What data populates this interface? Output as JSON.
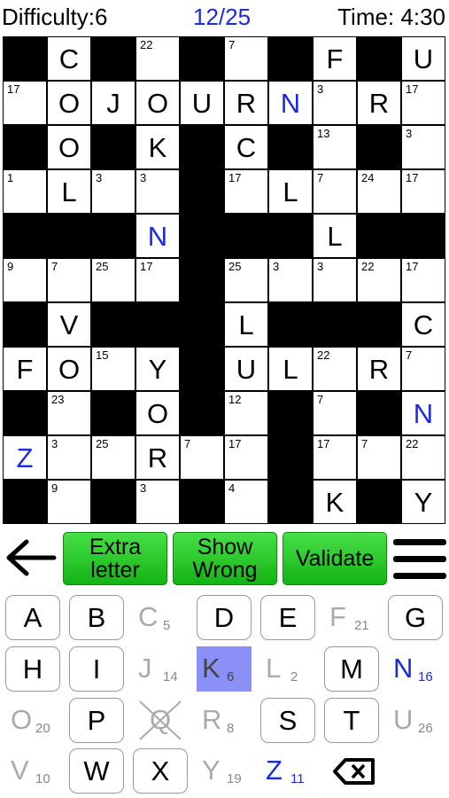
{
  "header": {
    "difficulty": "Difficulty:6",
    "progress": "12/25",
    "time": "Time: 4:30"
  },
  "grid": {
    "rows": [
      [
        "#",
        {
          "l": "C"
        },
        "#",
        {
          "n": "22"
        },
        "#",
        {
          "n": "7"
        },
        "#",
        {
          "l": "F"
        },
        "#",
        {
          "l": "U"
        }
      ],
      [
        {
          "n": "17"
        },
        {
          "l": "O"
        },
        {
          "l": "J"
        },
        {
          "l": "O"
        },
        {
          "l": "U"
        },
        {
          "l": "R"
        },
        {
          "l": "N",
          "c": "blue"
        },
        {
          "n": "3"
        },
        {
          "l": "R"
        },
        {
          "n": "17"
        }
      ],
      [
        "#",
        {
          "l": "O"
        },
        "#",
        {
          "l": "K"
        },
        "#",
        {
          "l": "C"
        },
        "#",
        {
          "n": "13"
        },
        "#",
        {
          "n": "3"
        }
      ],
      [
        {
          "n": "1"
        },
        {
          "l": "L"
        },
        {
          "n": "3"
        },
        {
          "n": "3"
        },
        "#",
        {
          "n": "17"
        },
        {
          "l": "L"
        },
        {
          "n": "7"
        },
        {
          "n": "24"
        },
        {
          "n": "17"
        }
      ],
      [
        "#",
        "#",
        "#",
        {
          "l": "N",
          "c": "blue"
        },
        "#",
        "#",
        "#",
        {
          "l": "L"
        },
        "#",
        "#"
      ],
      [
        {
          "n": "9"
        },
        {
          "n": "7"
        },
        {
          "n": "25"
        },
        {
          "n": "17"
        },
        "#",
        {
          "n": "25"
        },
        {
          "n": "3"
        },
        {
          "n": "3"
        },
        {
          "n": "22"
        },
        {
          "n": "17"
        }
      ],
      [
        "#",
        {
          "l": "V"
        },
        "#",
        "#",
        "#",
        {
          "l": "L"
        },
        "#",
        "#",
        "#",
        {
          "l": "C"
        }
      ],
      [
        {
          "l": "F"
        },
        {
          "l": "O"
        },
        {
          "n": "15"
        },
        {
          "l": "Y"
        },
        "#",
        {
          "l": "U"
        },
        {
          "l": "L"
        },
        {
          "n": "22"
        },
        {
          "l": "R"
        },
        {
          "n": "7"
        }
      ],
      [
        "#",
        {
          "n": "23"
        },
        "#",
        {
          "l": "O"
        },
        "#",
        {
          "n": "12"
        },
        "#",
        {
          "n": "7"
        },
        "#",
        {
          "l": "N",
          "c": "blue"
        }
      ],
      [
        {
          "l": "Z",
          "c": "blue"
        },
        {
          "n": "3"
        },
        {
          "n": "25"
        },
        {
          "l": "R"
        },
        {
          "n": "7"
        },
        {
          "n": "17"
        },
        "#",
        {
          "n": "17"
        },
        {
          "n": "7"
        },
        {
          "n": "22"
        }
      ],
      [
        "#",
        {
          "n": "9"
        },
        "#",
        {
          "n": "3"
        },
        "#",
        {
          "n": "4"
        },
        "#",
        {
          "l": "K"
        },
        "#",
        {
          "l": "Y"
        }
      ]
    ]
  },
  "actions": {
    "back_icon": "left-arrow-icon",
    "extra_letter": "Extra letter",
    "show_wrong": "Show Wrong",
    "validate": "Validate",
    "menu_icon": "hamburger-menu-icon"
  },
  "keyboard": {
    "rows": [
      [
        {
          "k": "A",
          "s": "avail"
        },
        {
          "k": "B",
          "s": "avail"
        },
        {
          "k": "C",
          "c": "5",
          "s": "used"
        },
        {
          "k": "D",
          "s": "avail"
        },
        {
          "k": "E",
          "s": "avail"
        },
        {
          "k": "F",
          "c": "21",
          "s": "used"
        },
        {
          "k": "G",
          "s": "avail"
        }
      ],
      [
        {
          "k": "H",
          "s": "avail"
        },
        {
          "k": "I",
          "s": "avail"
        },
        {
          "k": "J",
          "c": "14",
          "s": "used"
        },
        {
          "k": "K",
          "c": "6",
          "s": "selected"
        },
        {
          "k": "L",
          "c": "2",
          "s": "used"
        },
        {
          "k": "M",
          "s": "avail"
        },
        {
          "k": "N",
          "c": "16",
          "s": "blue"
        }
      ],
      [
        {
          "k": "O",
          "c": "20",
          "s": "used"
        },
        {
          "k": "P",
          "s": "avail"
        },
        {
          "k": "Q",
          "s": "crossed"
        },
        {
          "k": "R",
          "c": "8",
          "s": "used"
        },
        {
          "k": "S",
          "s": "avail"
        },
        {
          "k": "T",
          "s": "avail"
        },
        {
          "k": "U",
          "c": "26",
          "s": "used"
        }
      ],
      [
        {
          "k": "V",
          "c": "10",
          "s": "used"
        },
        {
          "k": "W",
          "s": "avail"
        },
        {
          "k": "X",
          "s": "avail"
        },
        {
          "k": "Y",
          "c": "19",
          "s": "used"
        },
        {
          "k": "Z",
          "c": "11",
          "s": "blue"
        },
        {
          "k": "",
          "s": "backspace"
        }
      ]
    ]
  }
}
